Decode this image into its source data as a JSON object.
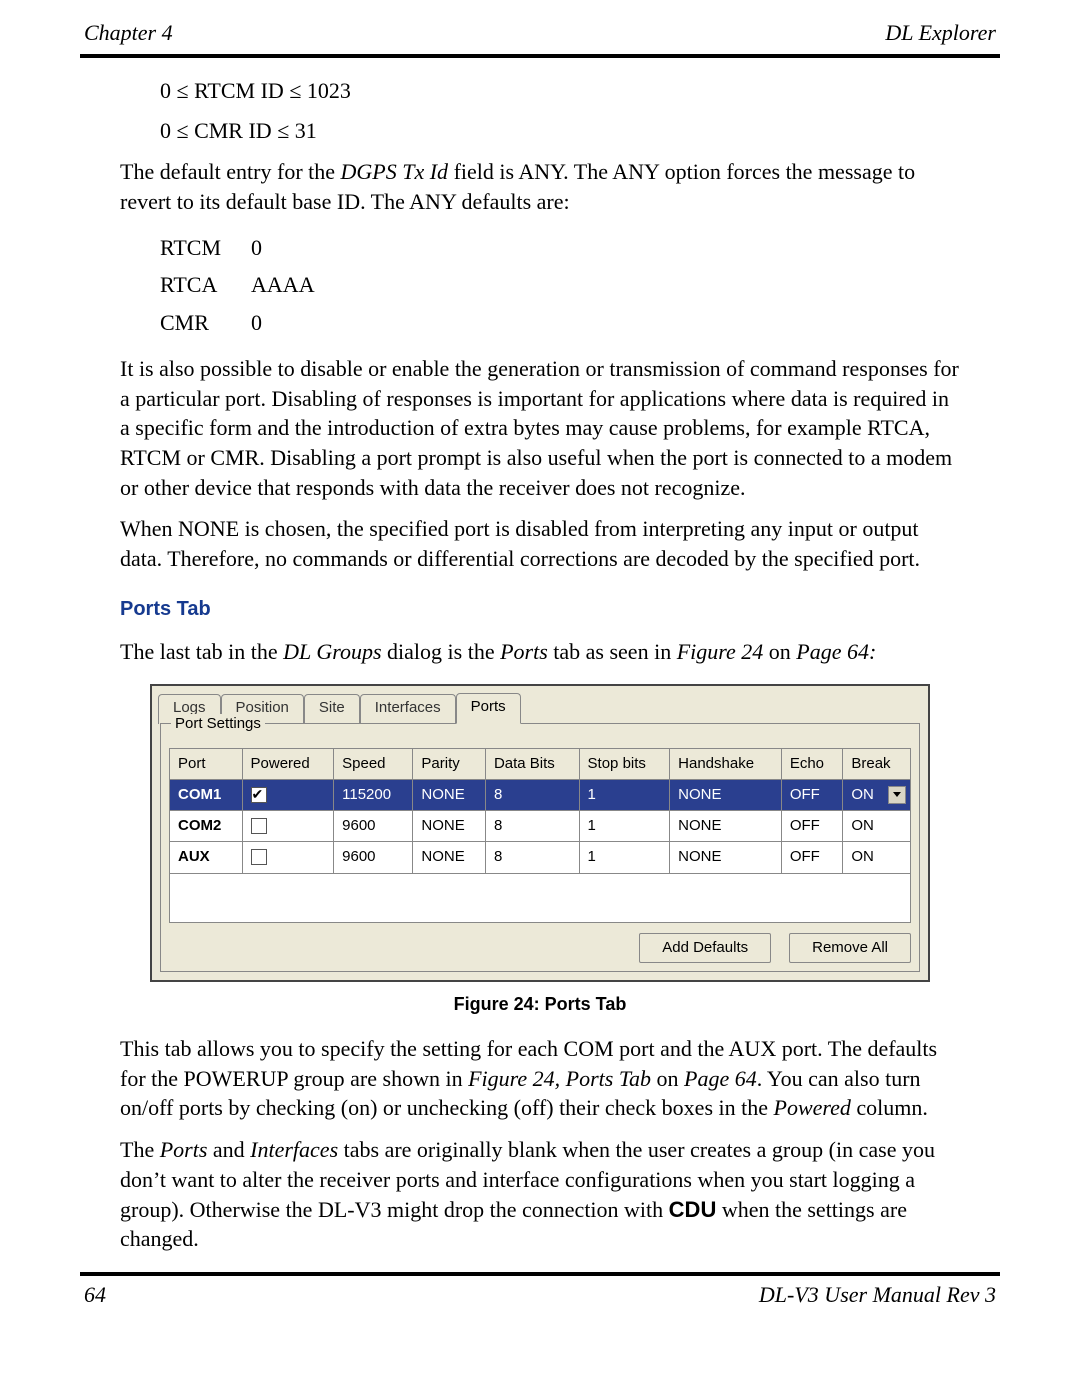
{
  "header": {
    "left": "Chapter 4",
    "right": "DL Explorer"
  },
  "constraints": {
    "rtcm": "0 ≤ RTCM ID ≤ 1023",
    "cmr": "0 ≤ CMR ID ≤ 31"
  },
  "para1_a": "The default entry for the ",
  "para1_em": "DGPS Tx Id",
  "para1_b": " field is ANY. The ANY option forces the message to revert to its default base ID. The ANY defaults are:",
  "defaults": {
    "rtcm_k": "RTCM",
    "rtcm_v": "0",
    "rtca_k": "RTCA",
    "rtca_v": "AAAA",
    "cmr_k": "CMR",
    "cmr_v": "0"
  },
  "para2": "It is also possible to disable or enable the generation or transmission of command responses for a particular port. Disabling of responses is important for applications where data is required in a specific form and the introduction of extra bytes may cause problems, for example RTCA, RTCM or CMR. Disabling a port prompt is also useful when the port is connected to a modem or other device that responds with data the receiver does not recognize.",
  "para3": "When NONE is chosen, the specified port is disabled from interpreting any input or output data. Therefore, no commands or differential corrections are decoded by the specified port.",
  "section_title": "Ports Tab",
  "para4_a": "The last tab in the ",
  "para4_em1": "DL Groups",
  "para4_b": " dialog is the ",
  "para4_em2": "Ports",
  "para4_c": " tab as seen in ",
  "para4_em3": "Figure 24",
  "para4_d": " on ",
  "para4_em4": "Page 64:",
  "dialog": {
    "tabs": [
      "Logs",
      "Position",
      "Site",
      "Interfaces",
      "Ports"
    ],
    "group_label": "Port Settings",
    "headers": [
      "Port",
      "Powered",
      "Speed",
      "Parity",
      "Data Bits",
      "Stop bits",
      "Handshake",
      "Echo",
      "Break"
    ],
    "rows": [
      {
        "port": "COM1",
        "powered": true,
        "speed": "115200",
        "parity": "NONE",
        "databits": "8",
        "stopbits": "1",
        "handshake": "NONE",
        "echo": "OFF",
        "brk": "ON",
        "selected": true
      },
      {
        "port": "COM2",
        "powered": false,
        "speed": "9600",
        "parity": "NONE",
        "databits": "8",
        "stopbits": "1",
        "handshake": "NONE",
        "echo": "OFF",
        "brk": "ON",
        "selected": false
      },
      {
        "port": "AUX",
        "powered": false,
        "speed": "9600",
        "parity": "NONE",
        "databits": "8",
        "stopbits": "1",
        "handshake": "NONE",
        "echo": "OFF",
        "brk": "ON",
        "selected": false
      }
    ],
    "btn_add": "Add Defaults",
    "btn_remove": "Remove All"
  },
  "fig_caption": "Figure 24: Ports Tab",
  "para5_a": "This tab allows you to specify the setting for each COM port and the AUX port. The defaults for the POWERUP group are shown in ",
  "para5_em1": "Figure 24, Ports Tab",
  "para5_b": " on ",
  "para5_em2": "Page 64",
  "para5_c": ". You can also turn on/off ports by checking (on) or unchecking (off) their check boxes in the ",
  "para5_em3": "Powered",
  "para5_d": " column.",
  "para6_a": "The ",
  "para6_em1": "Ports",
  "para6_b": " and ",
  "para6_em2": "Interfaces",
  "para6_c": " tabs are originally blank when the user creates a group (in case you don’t want to alter the receiver ports and interface configurations when you start logging a group). Otherwise the DL-V3 might drop the connection with ",
  "para6_bold": "CDU",
  "para6_d": " when the settings are changed.",
  "footer": {
    "left": "64",
    "right": "DL-V3 User Manual Rev 3"
  }
}
